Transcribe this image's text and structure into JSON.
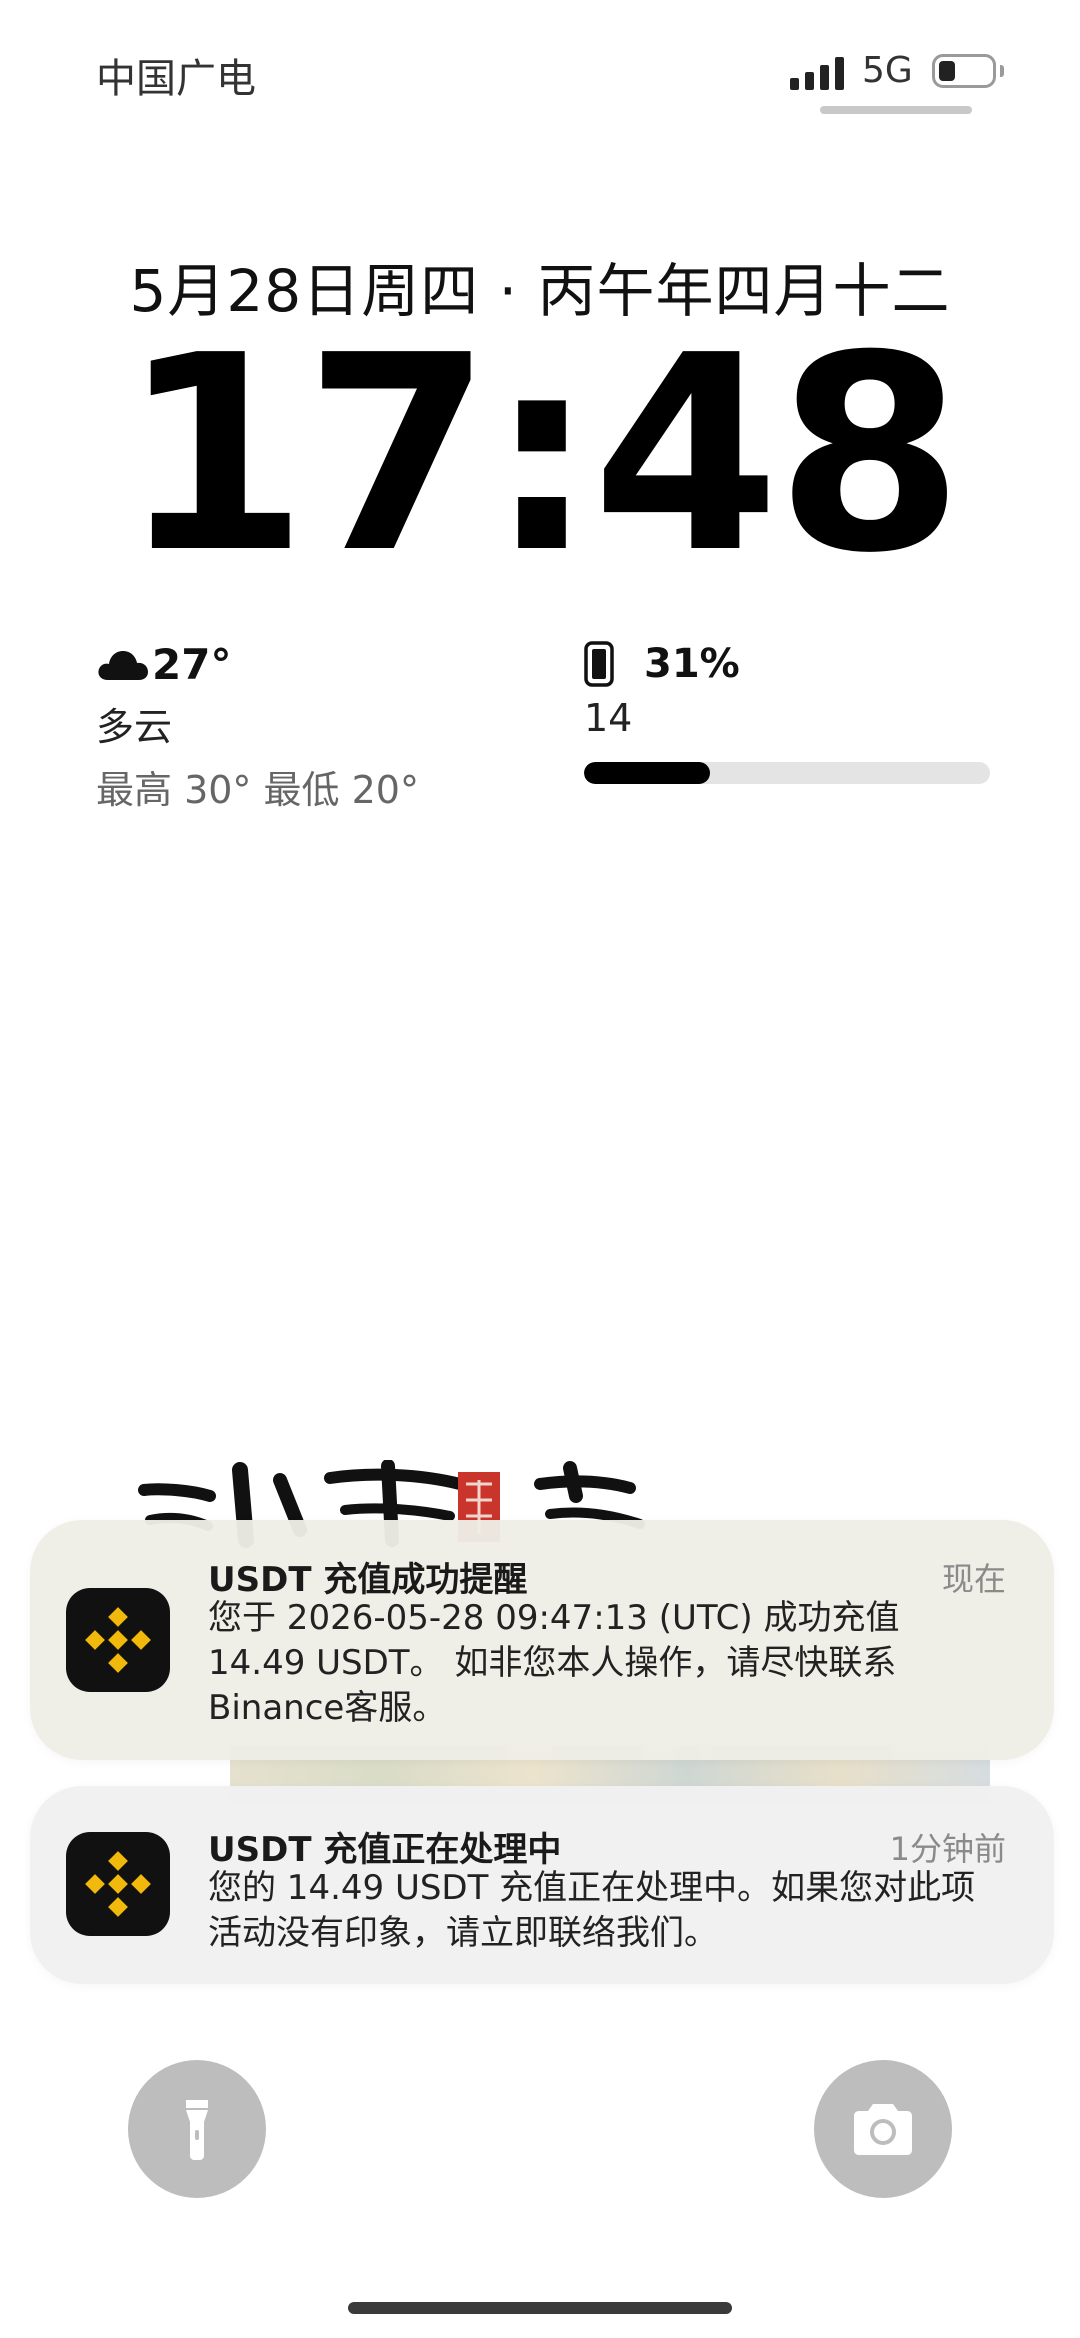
{
  "status_bar": {
    "carrier": "中国广电",
    "network": "5G",
    "battery_level": 0.31
  },
  "lock_screen": {
    "date": "5月28日周四 · 丙午年四月十二",
    "time": "17:48"
  },
  "weather_widget": {
    "icon": "cloud-icon",
    "temperature": "27°",
    "condition": "多云",
    "high_low": "最高 30° 最低 20°"
  },
  "battery_widget": {
    "icon": "phone-icon",
    "percent": "31%",
    "label": "14",
    "level": 0.31
  },
  "notifications": [
    {
      "app_icon": "binance-icon",
      "title": "USDT 充值成功提醒",
      "time": "现在",
      "body": "您于 2026-05-28 09:47:13 (UTC) 成功充值 14.49 USDT。 如非您本人操作，请尽快联系 Binance客服。"
    },
    {
      "app_icon": "binance-icon",
      "title": "USDT 充值正在处理中",
      "time": "1分钟前",
      "body": "您的 14.49 USDT 充值正在处理中。如果您对此项活动没有印象，请立即联络我们。"
    }
  ],
  "quick_actions": {
    "left_icon": "flashlight-icon",
    "right_icon": "camera-icon"
  },
  "colors": {
    "binance_yellow": "#F0B90B",
    "binance_bg": "#111111",
    "wallpaper_seal": "#c9352b"
  }
}
